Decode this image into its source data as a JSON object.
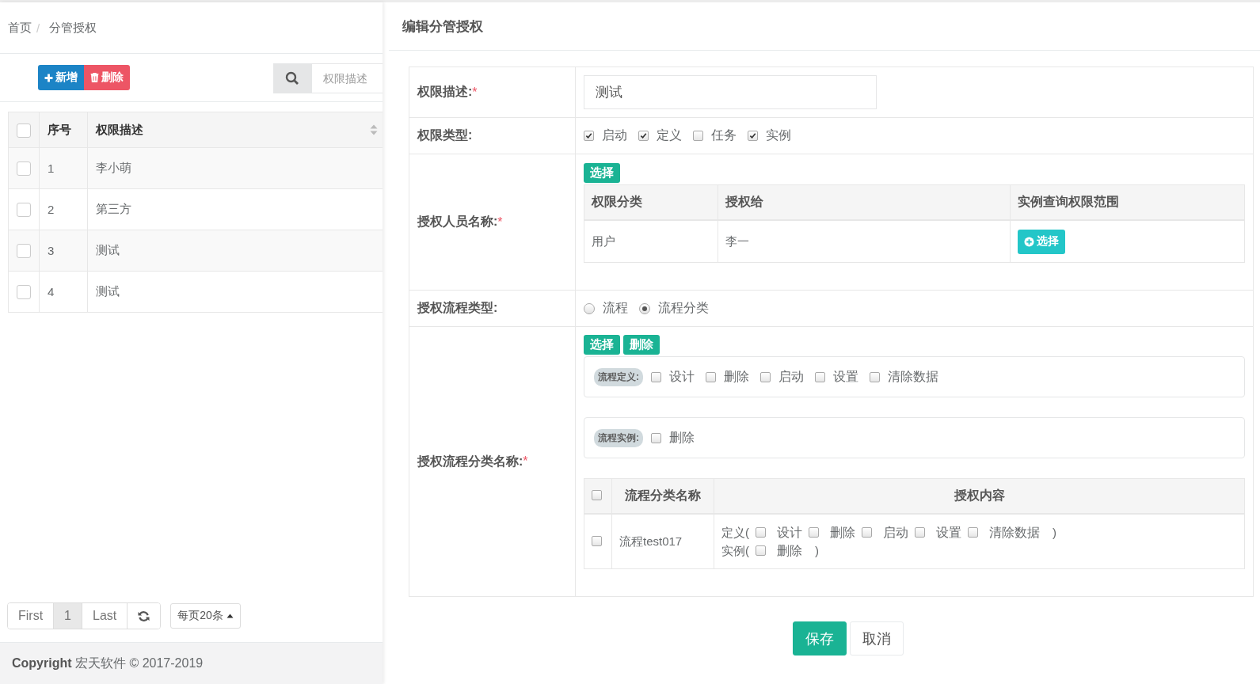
{
  "breadcrumb": {
    "items": [
      "首页",
      "分管授权"
    ],
    "separator": "/"
  },
  "toolbar": {
    "buttons": [
      {
        "kind": "add",
        "label": "新增"
      },
      {
        "kind": "delete",
        "label": "删除"
      }
    ],
    "search": {
      "placeholder": "权限描述"
    }
  },
  "table": {
    "header_checked": false,
    "columns": [
      "序号",
      "权限描述"
    ],
    "rows": [
      {
        "checked": false,
        "index": "1",
        "description": "李小萌"
      },
      {
        "checked": false,
        "index": "2",
        "description": "第三方"
      },
      {
        "checked": false,
        "index": "3",
        "description": "测试"
      },
      {
        "checked": false,
        "index": "4",
        "description": "测试"
      }
    ]
  },
  "pagination": {
    "first": "First",
    "pages": [
      {
        "label": "1",
        "selected": true
      }
    ],
    "last": "Last",
    "page_size": "每页20条"
  },
  "footer": {
    "text": "**Copyright** 宏天软件 © 2017-2019"
  },
  "editor": {
    "title": "编辑分管授权",
    "fields": [
      {
        "kind": "text",
        "label": "权限描述:",
        "required_mark": "*",
        "value": "测试"
      },
      {
        "kind": "checkboxes",
        "label": "权限类型:",
        "options": [
          {
            "label": "启动",
            "checked": true
          },
          {
            "label": "定义",
            "checked": true
          },
          {
            "label": "任务",
            "checked": false
          },
          {
            "label": "实例",
            "checked": true
          }
        ]
      },
      {
        "kind": "grantees",
        "label": "授权人员名称:",
        "required_mark": "*",
        "select_button": "选择",
        "columns": [
          "权限分类",
          "授权给",
          "实例查询权限范围"
        ],
        "rows": [
          {
            "category": "用户",
            "grantee": "李一",
            "action": "选择"
          }
        ]
      },
      {
        "kind": "radios",
        "label": "授权流程类型:",
        "options": [
          {
            "label": "流程",
            "selected": false
          },
          {
            "label": "流程分类",
            "selected": true
          }
        ]
      },
      {
        "kind": "categories",
        "label": "授权流程分类名称:",
        "required_mark": "*",
        "buttons": [
          "选择",
          "删除"
        ],
        "groups": [
          {
            "tag": "流程定义:",
            "options": [
              {
                "label": "设计",
                "checked": false
              },
              {
                "label": "删除",
                "checked": false
              },
              {
                "label": "启动",
                "checked": false
              },
              {
                "label": "设置",
                "checked": false
              },
              {
                "label": "清除数据",
                "checked": false
              }
            ]
          },
          {
            "tag": "流程实例:",
            "options": [
              {
                "label": "删除",
                "checked": false
              }
            ]
          }
        ],
        "header_checked": false,
        "columns": [
          "流程分类名称",
          "授权内容"
        ],
        "rows": [
          {
            "checked": false,
            "name": "流程test017",
            "lines": [
              {
                "prefix": "定义(",
                "options": [
                  {
                    "label": "设计",
                    "checked": false
                  },
                  {
                    "label": "删除",
                    "checked": false
                  },
                  {
                    "label": "启动",
                    "checked": false
                  },
                  {
                    "label": "设置",
                    "checked": false
                  },
                  {
                    "label": "清除数据",
                    "checked": false
                  }
                ],
                "suffix": ")"
              },
              {
                "prefix": "实例(",
                "options": [
                  {
                    "label": "删除",
                    "checked": false
                  }
                ],
                "suffix": ")"
              }
            ]
          }
        ]
      }
    ],
    "buttons": [
      {
        "kind": "primary",
        "label": "保存"
      },
      {
        "kind": "default",
        "label": "取消"
      }
    ]
  }
}
